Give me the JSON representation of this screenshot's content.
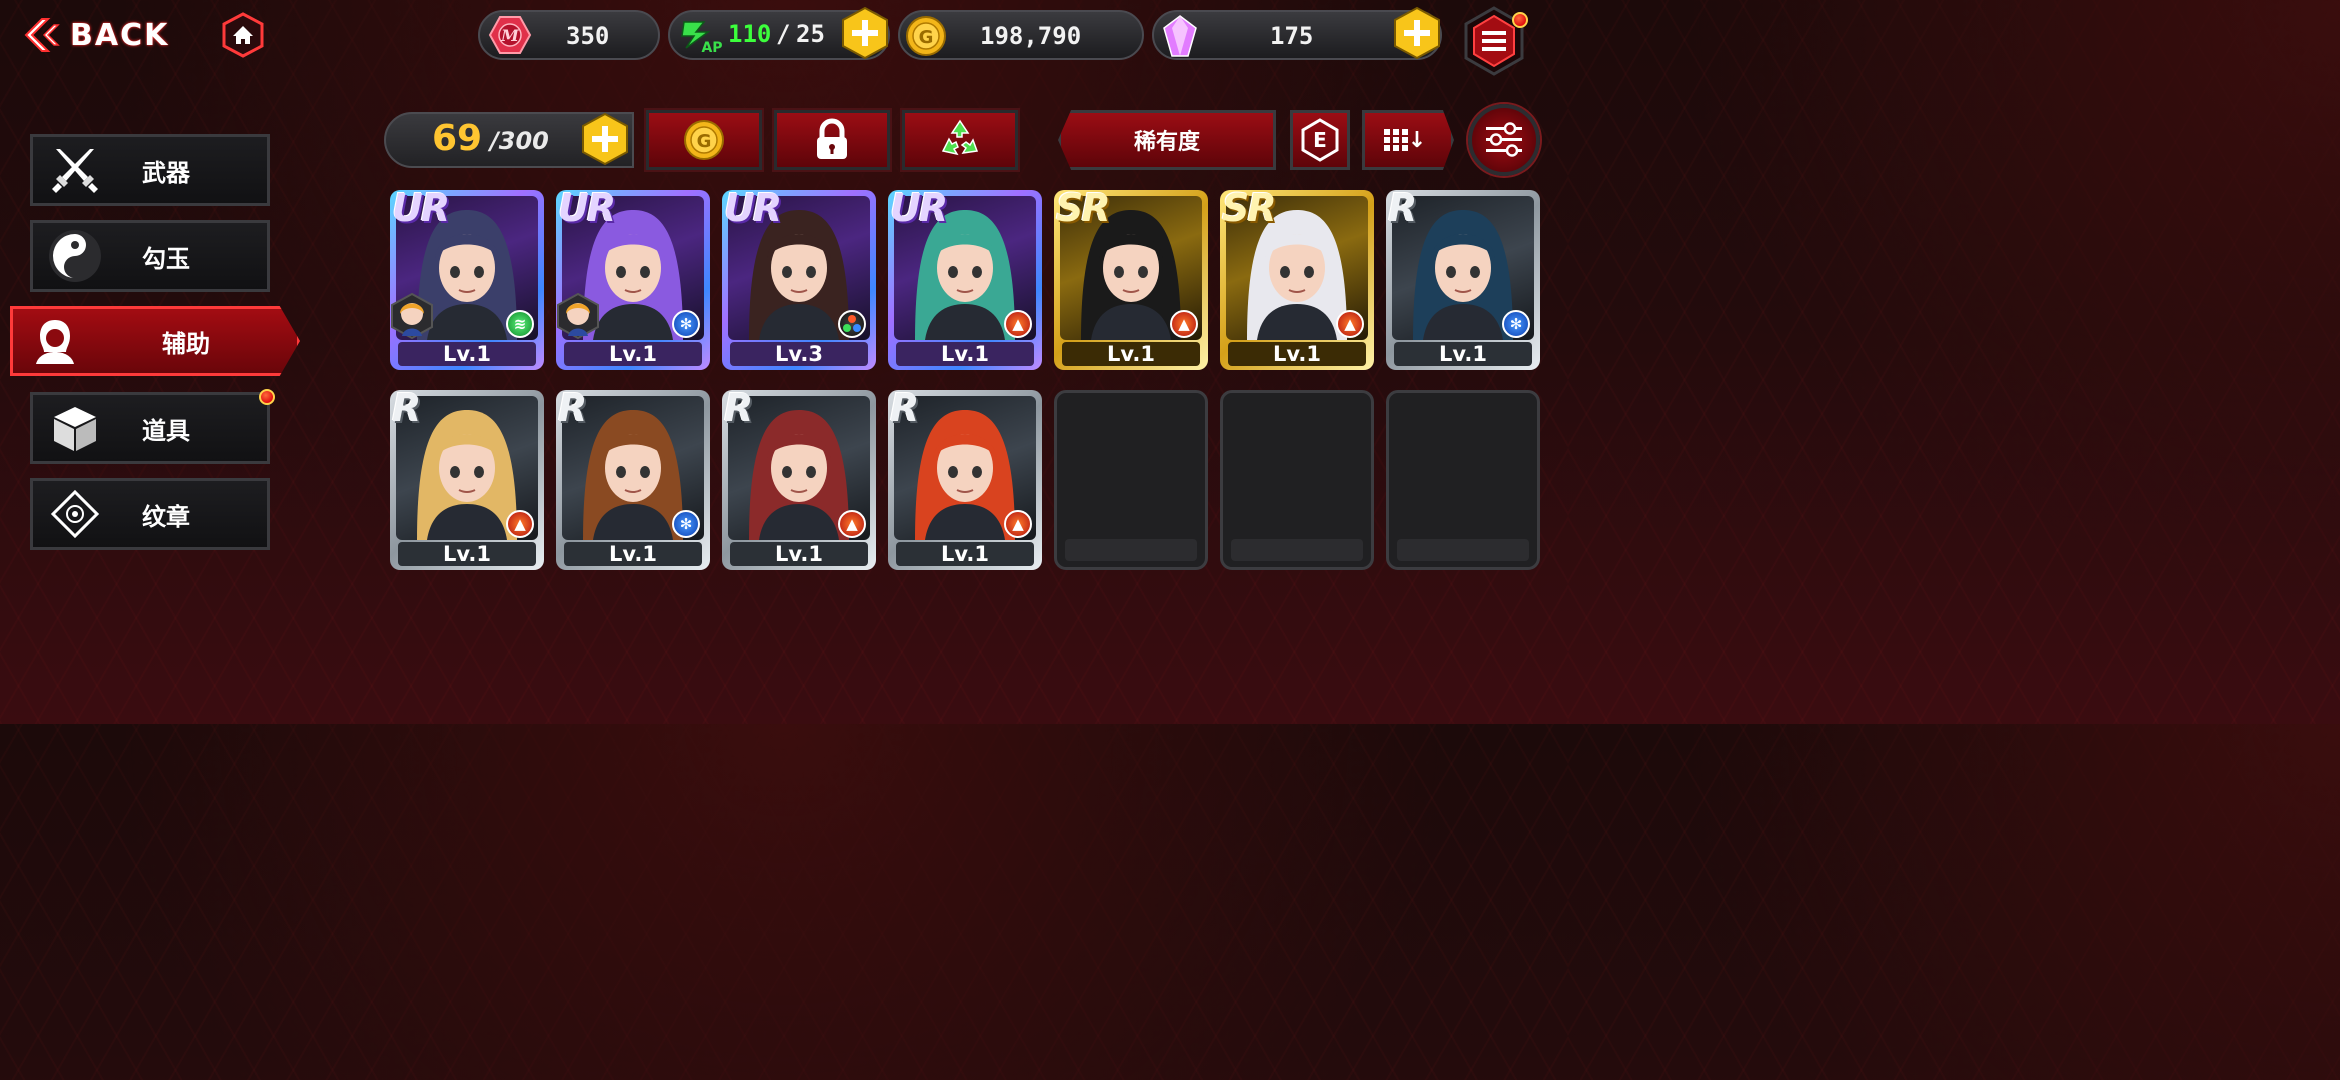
{
  "header": {
    "back_label": "BACK",
    "medal": {
      "icon": "medal-m-icon",
      "value": "350"
    },
    "ap": {
      "icon": "ap-icon",
      "icon_text": "AP",
      "current": "110",
      "separator": "/",
      "max": "25"
    },
    "gold": {
      "icon": "gold-coin-icon",
      "coin_letter": "G",
      "value": "198,790"
    },
    "crystal": {
      "icon": "crystal-icon",
      "value": "175"
    }
  },
  "sidebar": {
    "items": [
      {
        "label": "武器",
        "icon": "crossed-swords-icon",
        "active": false
      },
      {
        "label": "勾玉",
        "icon": "magatama-icon",
        "active": false
      },
      {
        "label": "辅助",
        "icon": "support-person-icon",
        "active": true
      },
      {
        "label": "道具",
        "icon": "box-icon",
        "active": false,
        "notification": true
      },
      {
        "label": "纹章",
        "icon": "emblem-icon",
        "active": false
      }
    ]
  },
  "toolbar": {
    "count": "69",
    "count_max": "/300",
    "rarity_label": "稀有度",
    "equip_filter": "E",
    "sort_label": "↓"
  },
  "cards": [
    {
      "rarity": "UR",
      "level": "Lv.1",
      "element": "wind",
      "has_chara_badge": true
    },
    {
      "rarity": "UR",
      "level": "Lv.1",
      "element": "water",
      "has_chara_badge": true
    },
    {
      "rarity": "UR",
      "level": "Lv.3",
      "element": "wind",
      "multi_element": true
    },
    {
      "rarity": "UR",
      "level": "Lv.1",
      "element": "fire"
    },
    {
      "rarity": "SR",
      "level": "Lv.1",
      "element": "fire"
    },
    {
      "rarity": "SR",
      "level": "Lv.1",
      "element": "fire"
    },
    {
      "rarity": "R",
      "level": "Lv.1",
      "element": "water"
    },
    {
      "rarity": "R",
      "level": "Lv.1",
      "element": "fire"
    },
    {
      "rarity": "R",
      "level": "Lv.1",
      "element": "water"
    },
    {
      "rarity": "R",
      "level": "Lv.1",
      "element": "fire"
    },
    {
      "rarity": "R",
      "level": "Lv.1",
      "element": "fire"
    }
  ],
  "empty_slots": 3,
  "colors": {
    "accent_red": "#a30c12",
    "gold_text": "#ffc531",
    "ap_green": "#3cff3c",
    "ur_frame": "#a070ff",
    "sr_frame": "#d4a019",
    "r_frame": "#8e979f"
  }
}
